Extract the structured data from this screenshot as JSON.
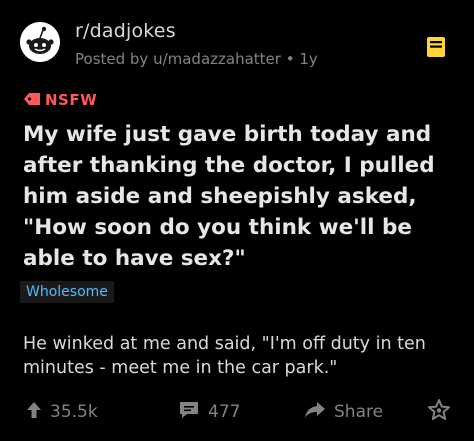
{
  "post": {
    "subreddit": "r/dadjokes",
    "posted_by": "Posted by u/madazzahatter • 1y",
    "nsfw_label": "NSFW",
    "title": "My wife just gave birth today and after thanking the doctor, I pulled him aside and sheepishly asked, \"How soon do you think we'll be able to have sex?\"",
    "flair": "Wholesome",
    "body": "He winked at me and said, \"I'm off duty in ten minutes - meet me in the car park.\""
  },
  "actions": {
    "upvotes": "35.5k",
    "comments": "477",
    "share_label": "Share"
  },
  "colors": {
    "background": "#000000",
    "nsfw": "#ff585b",
    "flair_text": "#4fbcff",
    "save_icon": "#ffd635",
    "muted": "#818384"
  },
  "icons": [
    "snoo-avatar-icon",
    "save-bookmark-icon",
    "nsfw-tag-icon",
    "upvote-arrow-icon",
    "comment-bubble-icon",
    "share-arrow-icon",
    "award-icon"
  ]
}
